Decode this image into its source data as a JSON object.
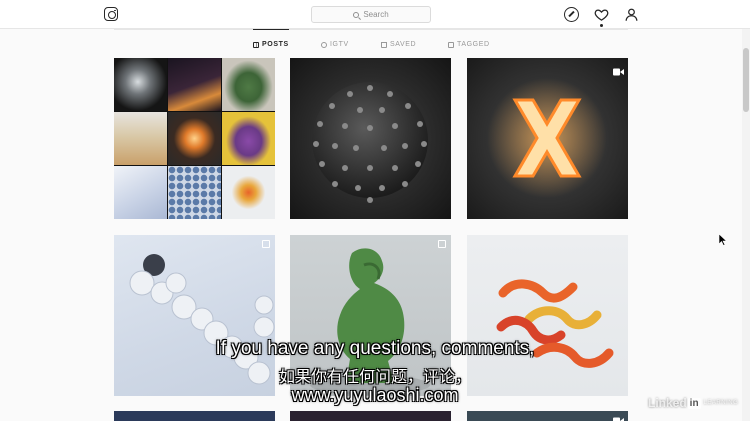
{
  "header": {
    "search_placeholder": "Search"
  },
  "tabs": [
    {
      "label": "POSTS",
      "active": true
    },
    {
      "label": "IGTV",
      "active": false
    },
    {
      "label": "SAVED",
      "active": false
    },
    {
      "label": "TAGGED",
      "active": false
    }
  ],
  "posts": [
    {
      "subject": "3x3 collage of 3D renders",
      "badge": "none"
    },
    {
      "subject": "dark spiked sphere",
      "badge": "none"
    },
    {
      "subject": "glowing X",
      "badge": "video"
    },
    {
      "subject": "white chain links",
      "badge": "multiple"
    },
    {
      "subject": "green thinker statue",
      "badge": "multiple"
    },
    {
      "subject": "gummy worms",
      "badge": "none"
    },
    {
      "subject": "partially visible post",
      "badge": "none"
    },
    {
      "subject": "partially visible post",
      "badge": "none"
    },
    {
      "subject": "partially visible post",
      "badge": "video"
    }
  ],
  "subtitles": {
    "line1": "If you have any questions, comments,",
    "line2": "如果你有任何问题，评论，",
    "line3": "www.yuyulaoshi.com"
  },
  "watermark": {
    "linked": "Linked",
    "in": "in",
    "learning": "LEARNING"
  },
  "icons": {
    "logo": "instagram-icon",
    "explore": "compass-icon",
    "activity": "heart-icon",
    "profile": "person-icon"
  },
  "colors": {
    "background": "#fafafa",
    "text": "#262626",
    "muted": "#8e8e8e"
  }
}
